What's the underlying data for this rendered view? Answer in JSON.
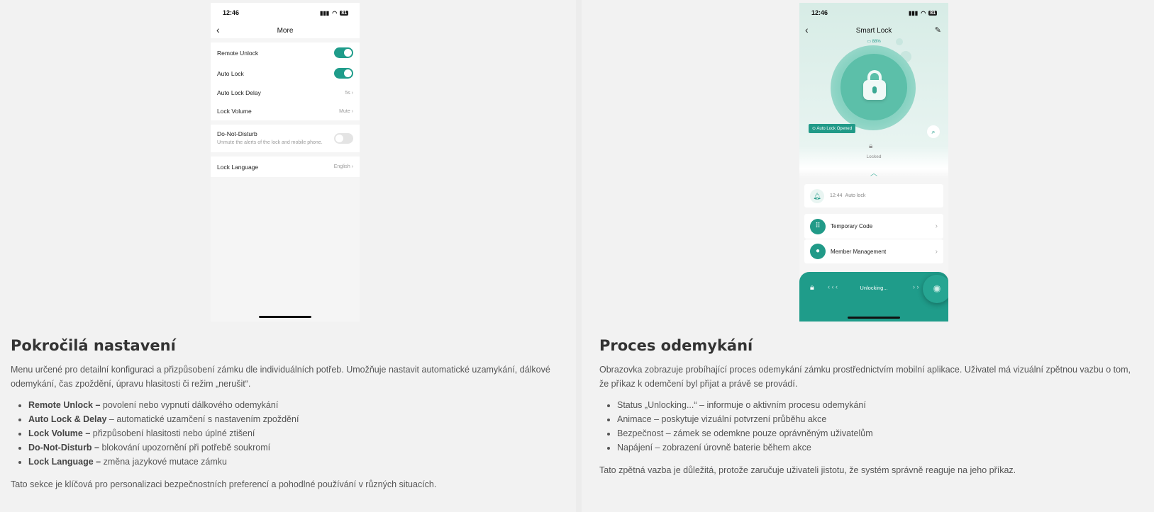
{
  "left": {
    "phone": {
      "time": "12:46",
      "battery": "81",
      "title": "More",
      "rows": {
        "remote_unlock": "Remote Unlock",
        "auto_lock": "Auto Lock",
        "auto_lock_delay": "Auto Lock Delay",
        "auto_lock_delay_value": "5s",
        "lock_volume": "Lock Volume",
        "lock_volume_value": "Mute",
        "dnd_title": "Do-Not-Disturb",
        "dnd_sub": "Unmute the alerts of the lock and mobile phone.",
        "lock_language": "Lock Language",
        "lock_language_value": "English"
      }
    },
    "heading": "Pokročilá nastavení",
    "intro": "Menu určené pro detailní konfiguraci a přizpůsobení zámku dle individuálních potřeb. Umožňuje nastavit automatické uzamykání, dálkové odemykání, čas zpoždění, úpravu hlasitosti či režim „nerušit“.",
    "bullets": [
      {
        "bold": "Remote Unlock –",
        "text": " povolení nebo vypnutí dálkového odemykání"
      },
      {
        "bold": "Auto Lock & Delay",
        "text": " – automatické uzamčení s nastavením zpoždění"
      },
      {
        "bold": "Lock Volume –",
        "text": " přizpůsobení hlasitosti nebo úplné ztišení"
      },
      {
        "bold": "Do-Not-Disturb –",
        "text": " blokování upozornění při potřebě soukromí"
      },
      {
        "bold": "Lock Language –",
        "text": " změna jazykové mutace zámku"
      }
    ],
    "outro": "Tato sekce je klíčová pro personalizaci bezpečnostních preferencí a pohodlné používání v různých situacích."
  },
  "right": {
    "phone": {
      "time": "12:46",
      "battery": "81",
      "title": "Smart Lock",
      "battery_pct": "88%",
      "auto_chip": "Auto Lock Opened",
      "locked": "Locked",
      "notif_time": "12:44",
      "notif_text": "Auto lock",
      "menu1": "Temporary Code",
      "menu2": "Member Management",
      "unlock_status": "Unlocking..."
    },
    "heading": "Proces odemykání",
    "intro": "Obrazovka zobrazuje probíhající proces odemykání zámku prostřednictvím mobilní aplikace. Uživatel má vizuální zpětnou vazbu o tom, že příkaz k odemčení byl přijat a právě se provádí.",
    "bullets": [
      "Status „Unlocking...“ – informuje o aktivním procesu odemykání",
      "Animace – poskytuje vizuální potvrzení průběhu akce",
      "Bezpečnost – zámek se odemkne pouze oprávněným uživatelům",
      "Napájení – zobrazení úrovně baterie během akce"
    ],
    "outro": "Tato zpětná vazba je důležitá, protože zaručuje uživateli jistotu, že systém správně reaguje na jeho příkaz."
  }
}
